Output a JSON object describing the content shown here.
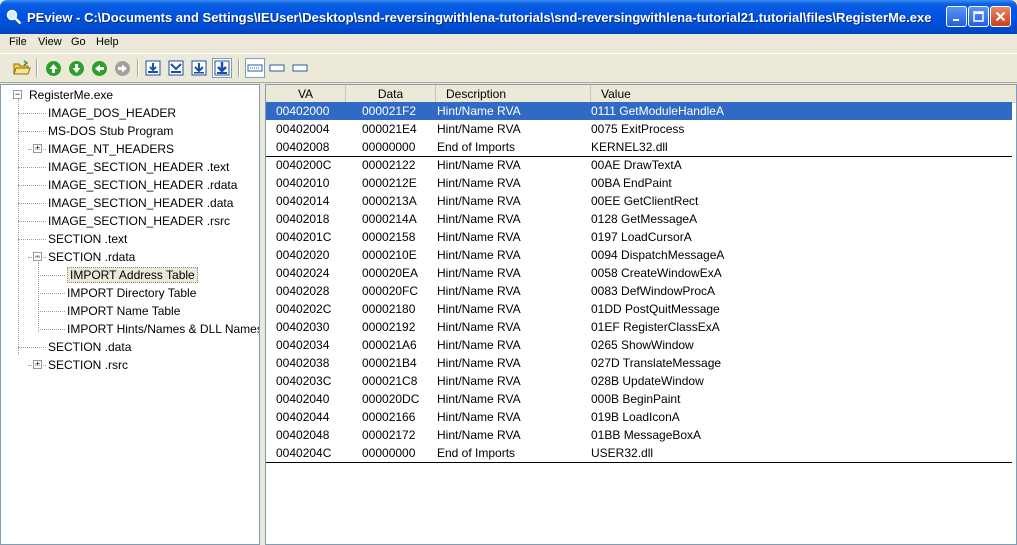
{
  "window": {
    "title": "PEview - C:\\Documents and Settings\\IEUser\\Desktop\\snd-reversingwithlena-tutorials\\snd-reversingwithlena-tutorial21.tutorial\\files\\RegisterMe.exe"
  },
  "menu": [
    "File",
    "View",
    "Go",
    "Help"
  ],
  "tree": [
    {
      "label": "RegisterMe.exe",
      "level": 0,
      "expander": "-"
    },
    {
      "label": "IMAGE_DOS_HEADER",
      "level": 1
    },
    {
      "label": "MS-DOS Stub Program",
      "level": 1
    },
    {
      "label": "IMAGE_NT_HEADERS",
      "level": 1,
      "expander": "+"
    },
    {
      "label": "IMAGE_SECTION_HEADER .text",
      "level": 1
    },
    {
      "label": "IMAGE_SECTION_HEADER .rdata",
      "level": 1
    },
    {
      "label": "IMAGE_SECTION_HEADER .data",
      "level": 1
    },
    {
      "label": "IMAGE_SECTION_HEADER .rsrc",
      "level": 1
    },
    {
      "label": "SECTION .text",
      "level": 1
    },
    {
      "label": "SECTION .rdata",
      "level": 1,
      "expander": "-"
    },
    {
      "label": "IMPORT Address Table",
      "level": 2,
      "selected": true
    },
    {
      "label": "IMPORT Directory Table",
      "level": 2
    },
    {
      "label": "IMPORT Name Table",
      "level": 2
    },
    {
      "label": "IMPORT Hints/Names & DLL Names",
      "level": 2
    },
    {
      "label": "SECTION .data",
      "level": 1
    },
    {
      "label": "SECTION .rsrc",
      "level": 1,
      "expander": "+"
    }
  ],
  "columns": [
    "VA",
    "Data",
    "Description",
    "Value"
  ],
  "rows": [
    {
      "va": "00402000",
      "data": "000021F2",
      "desc": "Hint/Name RVA",
      "value": "0111  GetModuleHandleA",
      "selected": true
    },
    {
      "va": "00402004",
      "data": "000021E4",
      "desc": "Hint/Name RVA",
      "value": "0075  ExitProcess"
    },
    {
      "va": "00402008",
      "data": "00000000",
      "desc": "End of Imports",
      "value": "KERNEL32.dll",
      "sep_after": true
    },
    {
      "va": "0040200C",
      "data": "00002122",
      "desc": "Hint/Name RVA",
      "value": "00AE  DrawTextA"
    },
    {
      "va": "00402010",
      "data": "0000212E",
      "desc": "Hint/Name RVA",
      "value": "00BA  EndPaint"
    },
    {
      "va": "00402014",
      "data": "0000213A",
      "desc": "Hint/Name RVA",
      "value": "00EE  GetClientRect"
    },
    {
      "va": "00402018",
      "data": "0000214A",
      "desc": "Hint/Name RVA",
      "value": "0128  GetMessageA"
    },
    {
      "va": "0040201C",
      "data": "00002158",
      "desc": "Hint/Name RVA",
      "value": "0197  LoadCursorA"
    },
    {
      "va": "00402020",
      "data": "0000210E",
      "desc": "Hint/Name RVA",
      "value": "0094  DispatchMessageA"
    },
    {
      "va": "00402024",
      "data": "000020EA",
      "desc": "Hint/Name RVA",
      "value": "0058  CreateWindowExA"
    },
    {
      "va": "00402028",
      "data": "000020FC",
      "desc": "Hint/Name RVA",
      "value": "0083  DefWindowProcA"
    },
    {
      "va": "0040202C",
      "data": "00002180",
      "desc": "Hint/Name RVA",
      "value": "01DD  PostQuitMessage"
    },
    {
      "va": "00402030",
      "data": "00002192",
      "desc": "Hint/Name RVA",
      "value": "01EF  RegisterClassExA"
    },
    {
      "va": "00402034",
      "data": "000021A6",
      "desc": "Hint/Name RVA",
      "value": "0265  ShowWindow"
    },
    {
      "va": "00402038",
      "data": "000021B4",
      "desc": "Hint/Name RVA",
      "value": "027D  TranslateMessage"
    },
    {
      "va": "0040203C",
      "data": "000021C8",
      "desc": "Hint/Name RVA",
      "value": "028B  UpdateWindow"
    },
    {
      "va": "00402040",
      "data": "000020DC",
      "desc": "Hint/Name RVA",
      "value": "000B  BeginPaint"
    },
    {
      "va": "00402044",
      "data": "00002166",
      "desc": "Hint/Name RVA",
      "value": "019B  LoadIconA"
    },
    {
      "va": "00402048",
      "data": "00002172",
      "desc": "Hint/Name RVA",
      "value": "01BB  MessageBoxA"
    },
    {
      "va": "0040204C",
      "data": "00000000",
      "desc": "End of Imports",
      "value": "USER32.dll",
      "sep_after": true
    }
  ],
  "colors": {
    "selection": "#316ac5",
    "titlebar": "#0054e3",
    "face": "#ece9d8"
  }
}
